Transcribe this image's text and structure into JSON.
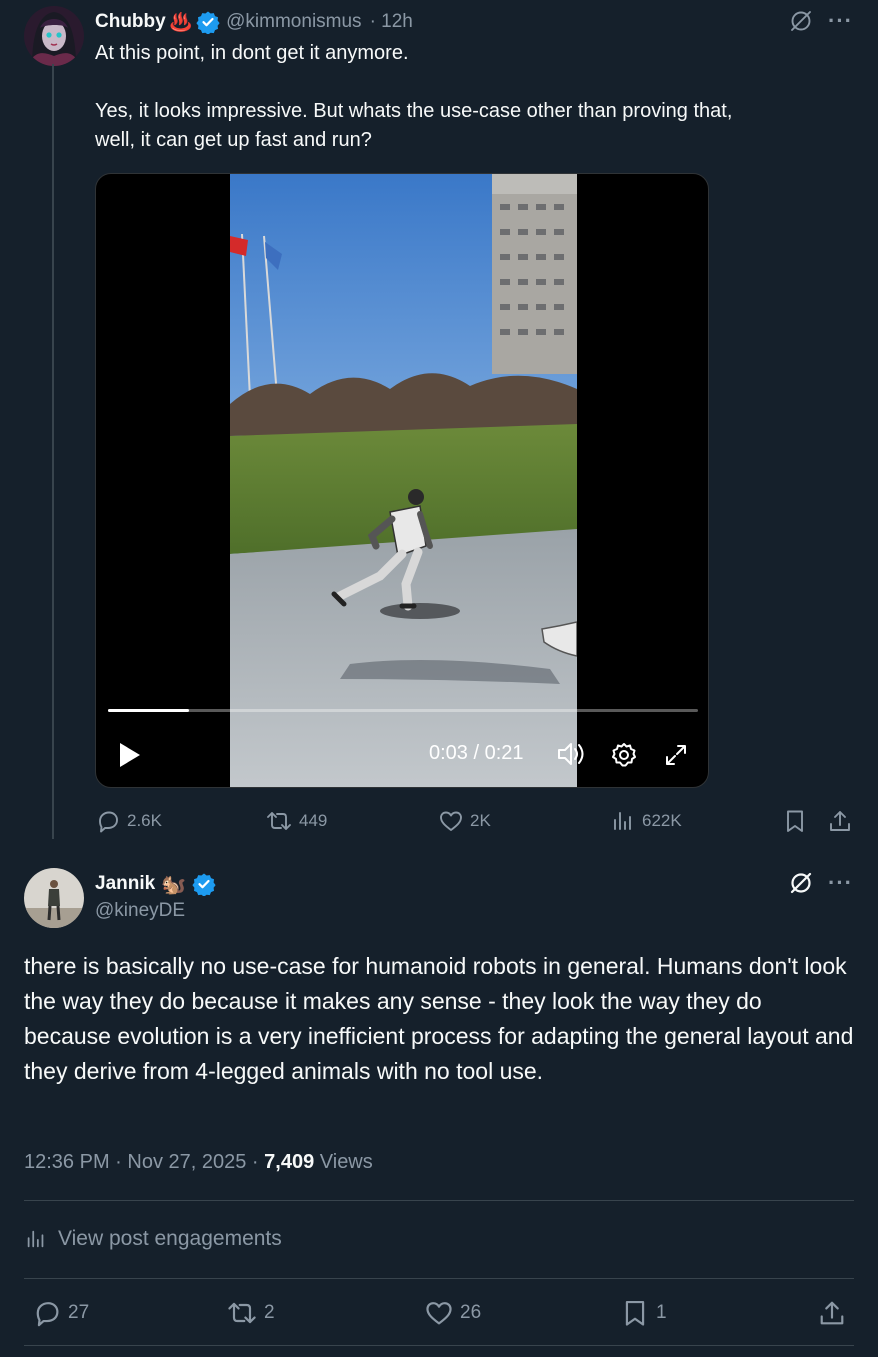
{
  "original_tweet": {
    "author_name": "Chubby",
    "author_emoji": "♨️",
    "handle": "@kimmonismus",
    "time": "· 12h",
    "text_line1": "At this point, in dont get it anymore.",
    "text_line2": "Yes, it looks impressive. But whats the use-case other than proving that,",
    "text_line3": "well, it can get up fast and run?",
    "video": {
      "current_time": "0:03",
      "duration": "0:21",
      "time_display": "0:03 / 0:21",
      "progress_fraction": 0.137
    },
    "actions": {
      "replies": "2.6K",
      "reposts": "449",
      "likes": "2K",
      "views": "622K"
    }
  },
  "reply": {
    "author_name": "Jannik",
    "author_emoji": "🐿️",
    "handle": "@kineyDE",
    "text": "there is basically no use-case for humanoid robots in general. Humans don't look the way they do because it makes any sense - they look the way they do because evolution is a very inefficient process for adapting the general layout and they derive from 4-legged animals with no tool use.",
    "time": "12:36 PM · Nov 27, 2025 ·",
    "views_count": "7,409",
    "views_label": "Views",
    "engagements_label": "View post engagements",
    "actions": {
      "replies": "27",
      "reposts": "2",
      "likes": "26",
      "bookmarks": "1"
    }
  },
  "colors": {
    "background": "#15202b",
    "text": "#f7f9f9",
    "muted": "#8b98a5",
    "verified": "#1d9bf0",
    "divider": "#38444d"
  }
}
